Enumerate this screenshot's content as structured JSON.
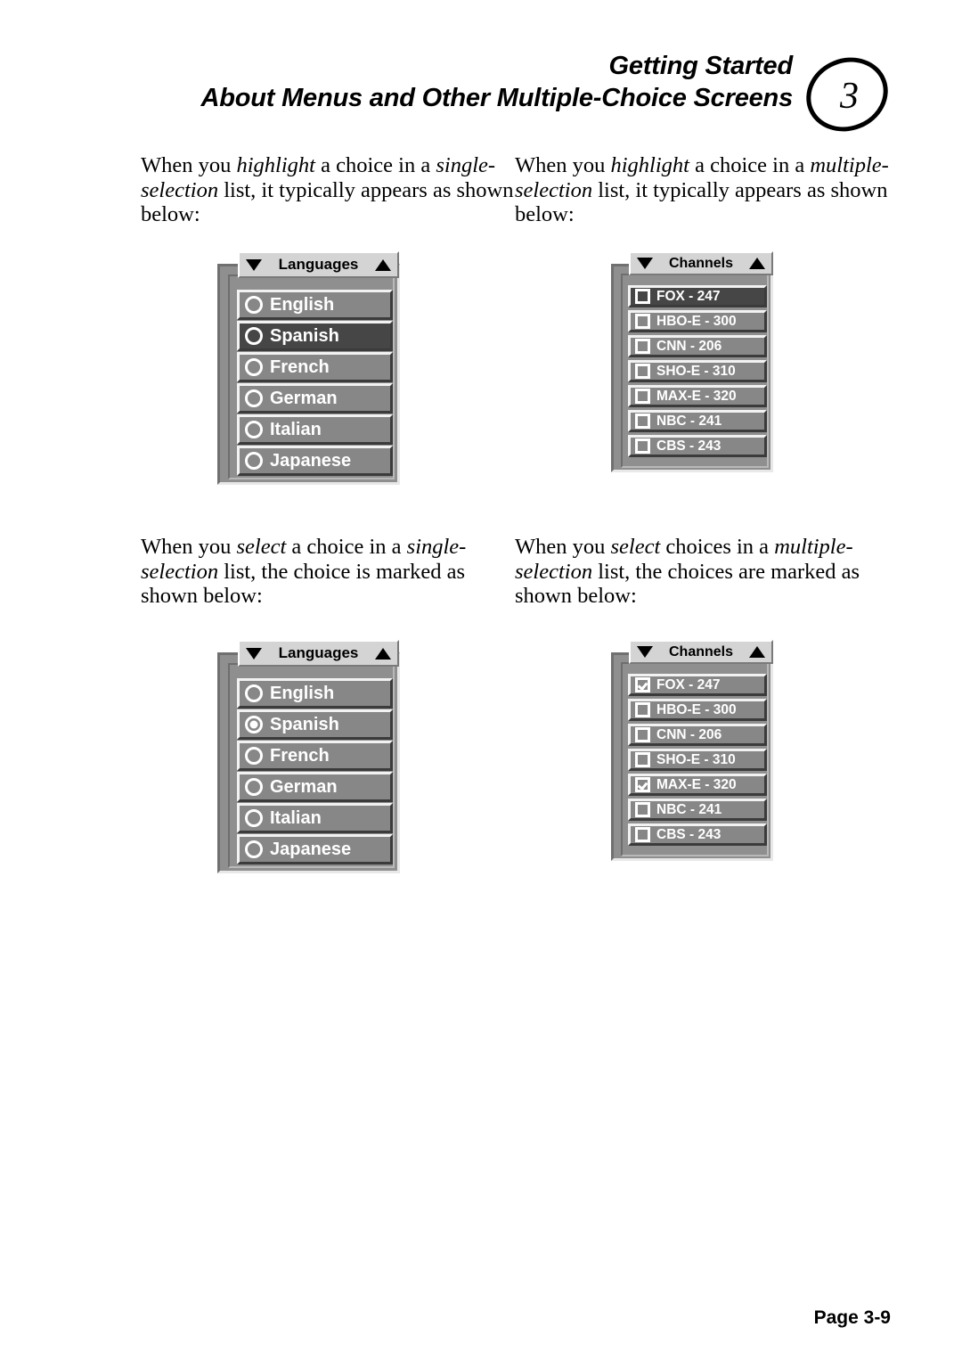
{
  "header": {
    "title_line1": "Getting Started",
    "title_line2": "About Menus and Other Multiple-Choice Screens",
    "chapter_number": "3"
  },
  "paragraphs": {
    "p1": {
      "seg1": "When you ",
      "em1": "highlight",
      "seg2": " a choice in a ",
      "em2": "single-selection",
      "seg3": " list, it typically appears as shown below:"
    },
    "p2": {
      "seg1": "When you ",
      "em1": "highlight",
      "seg2": " a choice in a ",
      "em2": "multiple-selection",
      "seg3": " list, it typically appears as shown below:"
    },
    "p3": {
      "seg1": "When you ",
      "em1": "select",
      "seg2": " a choice in a ",
      "em2": "single-selection",
      "seg3": " list, the choice is marked as shown below:"
    },
    "p4": {
      "seg1": "When you ",
      "em1": "select",
      "seg2": " choices in a ",
      "em2": "multiple-selection",
      "seg3": " list, the choices are marked as shown below:"
    }
  },
  "widgets": {
    "languages_highlight": {
      "title": "Languages",
      "scroll_up_icon": "triangle-up-icon",
      "scroll_down_icon": "triangle-down-icon",
      "control_type": "radio",
      "rows": [
        {
          "label": "English",
          "selected": false,
          "highlighted": false
        },
        {
          "label": "Spanish",
          "selected": false,
          "highlighted": true
        },
        {
          "label": "French",
          "selected": false,
          "highlighted": false
        },
        {
          "label": "German",
          "selected": false,
          "highlighted": false
        },
        {
          "label": "Italian",
          "selected": false,
          "highlighted": false
        },
        {
          "label": "Japanese",
          "selected": false,
          "highlighted": false
        }
      ]
    },
    "channels_highlight": {
      "title": "Channels",
      "scroll_up_icon": "triangle-up-icon",
      "scroll_down_icon": "triangle-down-icon",
      "control_type": "checkbox",
      "rows": [
        {
          "label": "FOX - 247",
          "selected": false,
          "highlighted": true
        },
        {
          "label": "HBO-E - 300",
          "selected": false,
          "highlighted": false
        },
        {
          "label": "CNN - 206",
          "selected": false,
          "highlighted": false
        },
        {
          "label": "SHO-E - 310",
          "selected": false,
          "highlighted": false
        },
        {
          "label": "MAX-E - 320",
          "selected": false,
          "highlighted": false
        },
        {
          "label": "NBC - 241",
          "selected": false,
          "highlighted": false
        },
        {
          "label": "CBS - 243",
          "selected": false,
          "highlighted": false
        }
      ]
    },
    "languages_selected": {
      "title": "Languages",
      "scroll_up_icon": "triangle-up-icon",
      "scroll_down_icon": "triangle-down-icon",
      "control_type": "radio",
      "rows": [
        {
          "label": "English",
          "selected": false,
          "highlighted": false
        },
        {
          "label": "Spanish",
          "selected": true,
          "highlighted": false
        },
        {
          "label": "French",
          "selected": false,
          "highlighted": false
        },
        {
          "label": "German",
          "selected": false,
          "highlighted": false
        },
        {
          "label": "Italian",
          "selected": false,
          "highlighted": false
        },
        {
          "label": "Japanese",
          "selected": false,
          "highlighted": false
        }
      ]
    },
    "channels_selected": {
      "title": "Channels",
      "scroll_up_icon": "triangle-up-icon",
      "scroll_down_icon": "triangle-down-icon",
      "control_type": "checkbox",
      "rows": [
        {
          "label": "FOX - 247",
          "selected": true,
          "highlighted": false
        },
        {
          "label": "HBO-E - 300",
          "selected": false,
          "highlighted": false
        },
        {
          "label": "CNN - 206",
          "selected": false,
          "highlighted": false
        },
        {
          "label": "SHO-E - 310",
          "selected": false,
          "highlighted": false
        },
        {
          "label": "MAX-E - 320",
          "selected": true,
          "highlighted": false
        },
        {
          "label": "NBC - 241",
          "selected": false,
          "highlighted": false
        },
        {
          "label": "CBS - 243",
          "selected": false,
          "highlighted": false
        }
      ]
    }
  },
  "footer": {
    "page_label": "Page 3-9"
  }
}
